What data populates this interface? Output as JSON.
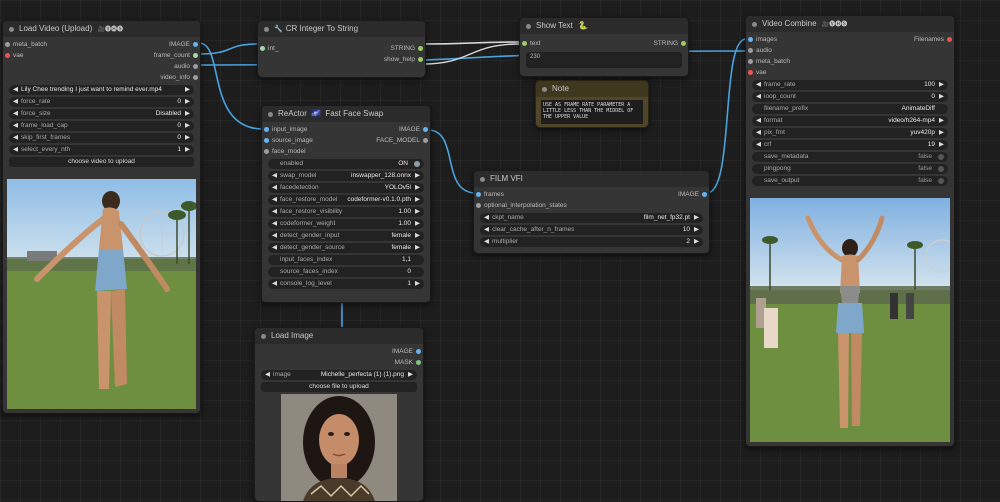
{
  "colors": {
    "image": "#64b5f6",
    "int": "#a5d6a7",
    "string": "#9ccc65",
    "vae": "#ef5350",
    "audio": "#9e9e9e",
    "mask": "#81c784",
    "generic": "#9e9e9e",
    "wire_image": "#4aa3df",
    "wire_string": "#d6d6d6",
    "toggle_on": "#8aa0a8",
    "toggle_off": "#555555",
    "note_bg": "#50462a"
  },
  "load_video": {
    "title": "Load Video (Upload)",
    "title_badge": "🎥🅥🅗🅢",
    "inputs": [
      "meta_batch",
      "vae"
    ],
    "outputs": [
      "IMAGE",
      "frame_count",
      "audio",
      "video_info"
    ],
    "video_file": "Lily Chee trending I just want to remind ever.mp4",
    "widgets": [
      {
        "label": "force_rate",
        "value": "0"
      },
      {
        "label": "force_size",
        "value": "Disabled"
      },
      {
        "label": "frame_load_cap",
        "value": "0"
      },
      {
        "label": "skip_first_frames",
        "value": "0"
      },
      {
        "label": "select_every_nth",
        "value": "1"
      }
    ],
    "upload_button": "choose video to upload"
  },
  "cr_integer": {
    "title": "CR Integer To String",
    "inputs": [
      "int_"
    ],
    "outputs": [
      "STRING",
      "show_help"
    ]
  },
  "show_text": {
    "title": "Show Text",
    "title_badge": "🐍",
    "inputs": [
      "text"
    ],
    "outputs": [
      "STRING"
    ],
    "value": "230"
  },
  "note": {
    "title": "Note",
    "text": "USE AS FRAME RATE PARAMETER A LITTLE LESS THAN THE MIDDEL OF THE UPPER VALUE"
  },
  "reactor": {
    "title": "ReActor",
    "title_icon": "🌌",
    "title_rest": "Fast Face Swap",
    "inputs": [
      "input_image",
      "source_image",
      "face_model"
    ],
    "outputs": [
      "IMAGE",
      "FACE_MODEL"
    ],
    "enabled": {
      "label": "enabled",
      "value": "ON"
    },
    "widgets": [
      {
        "label": "swap_model",
        "value": "inswapper_128.onnx"
      },
      {
        "label": "facedetection",
        "value": "YOLOv5l"
      },
      {
        "label": "face_restore_model",
        "value": "codeformer-v0.1.0.pth"
      },
      {
        "label": "face_restore_visibility",
        "value": "1.00"
      },
      {
        "label": "codeformer_weight",
        "value": "1.00"
      },
      {
        "label": "detect_gender_input",
        "value": "female"
      },
      {
        "label": "detect_gender_source",
        "value": "female"
      }
    ],
    "text_widgets": [
      {
        "label": "input_faces_index",
        "value": "1,1"
      },
      {
        "label": "source_faces_index",
        "value": "0"
      }
    ],
    "console": {
      "label": "console_log_level",
      "value": "1"
    }
  },
  "film_vfi": {
    "title": "FILM VFI",
    "inputs": [
      "frames",
      "optional_interpolation_states"
    ],
    "outputs": [
      "IMAGE"
    ],
    "widgets": [
      {
        "label": "ckpt_name",
        "value": "film_net_fp32.pt"
      },
      {
        "label": "clear_cache_after_n_frames",
        "value": "10"
      },
      {
        "label": "multiplier",
        "value": "2"
      }
    ]
  },
  "load_image": {
    "title": "Load Image",
    "outputs": [
      "IMAGE",
      "MASK"
    ],
    "image": {
      "label": "image",
      "value": "Michelle_perfecta (1) (1).png"
    },
    "upload_button": "choose file to upload"
  },
  "video_combine": {
    "title": "Video Combine",
    "title_badge": "🎥🅥🅗🅢",
    "inputs": [
      "images",
      "audio",
      "meta_batch",
      "vae"
    ],
    "outputs": [
      "Filenames"
    ],
    "widgets": [
      {
        "label": "frame_rate",
        "value": "100"
      },
      {
        "label": "loop_count",
        "value": "0"
      },
      {
        "label": "filename_prefix",
        "value": "AnimateDiff"
      },
      {
        "label": "format",
        "value": "video/h264-mp4"
      },
      {
        "label": "pix_fmt",
        "value": "yuv420p"
      },
      {
        "label": "crf",
        "value": "19"
      }
    ],
    "toggles": [
      {
        "label": "save_metadata",
        "value": "false"
      },
      {
        "label": "pingpong",
        "value": "false"
      },
      {
        "label": "save_output",
        "value": "false"
      }
    ]
  }
}
